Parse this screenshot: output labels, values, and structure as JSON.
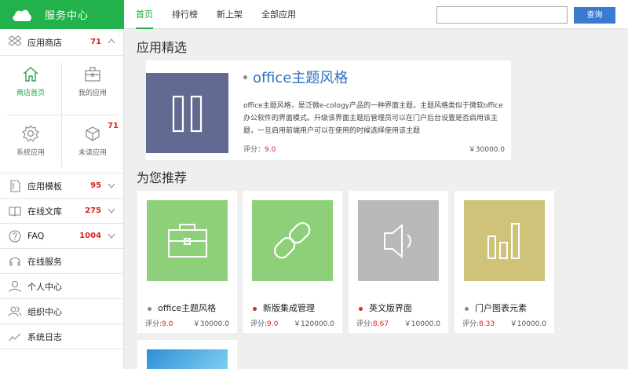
{
  "brand": {
    "title": "服务中心"
  },
  "nav": {
    "tabs": [
      "首页",
      "排行榜",
      "新上架",
      "全部应用"
    ]
  },
  "search": {
    "placeholder": "",
    "button": "查询"
  },
  "sidebar": {
    "app_store": {
      "label": "应用商店",
      "count": "71"
    },
    "grid": [
      {
        "label": "商店首页",
        "icon": "home-icon"
      },
      {
        "label": "我的应用",
        "icon": "toolbox-icon"
      },
      {
        "label": "系统应用",
        "icon": "gear-icon"
      },
      {
        "label": "未读应用",
        "icon": "box-icon",
        "badge": "71"
      }
    ],
    "items": [
      {
        "label": "应用模板",
        "count": "95",
        "icon": "template-icon"
      },
      {
        "label": "在线文库",
        "count": "275",
        "icon": "book-icon"
      },
      {
        "label": "FAQ",
        "count": "1004",
        "icon": "question-icon"
      },
      {
        "label": "在线服务",
        "icon": "headset-icon"
      },
      {
        "label": "个人中心",
        "icon": "user-icon"
      },
      {
        "label": "组织中心",
        "icon": "org-icon"
      },
      {
        "label": "系统日志",
        "icon": "chart-line-icon"
      }
    ]
  },
  "featured_section": {
    "title": "应用精选"
  },
  "featured": {
    "title": "office主题风格",
    "description": "office主题风格，是泛微e-cology产品的一种界面主题，主题风格类似于微软office办公软件的界面模式。升级该界面主题后管理员可以在门户后台设置是否启用该主题，一旦启用前端用户可以在使用的时候选择使用该主题",
    "rating_label": "评分：",
    "rating": "9.0",
    "price": "￥30000.0"
  },
  "recommend_section": {
    "title": "为您推荐"
  },
  "cards": [
    {
      "title": "office主题风格",
      "rating_label": "评分:",
      "rating": "9.0",
      "price": "￥30000.0",
      "color": "#8ed07a",
      "dot": "#888888",
      "icon": "briefcase-icon"
    },
    {
      "title": "新版集成管理",
      "rating_label": "评分:",
      "rating": "9.0",
      "price": "￥120000.0",
      "color": "#8ed07a",
      "dot": "#d9301e",
      "icon": "link-icon"
    },
    {
      "title": "英文版界面",
      "rating_label": "评分:",
      "rating": "8.67",
      "price": "￥10000.0",
      "color": "#b9b9b9",
      "dot": "#d9301e",
      "icon": "speaker-icon"
    },
    {
      "title": "门户图表元素",
      "rating_label": "评分:",
      "rating": "8.33",
      "price": "￥10000.0",
      "color": "#cfc37a",
      "dot": "#888888",
      "icon": "bar-chart-icon"
    }
  ],
  "colors": {
    "brand_green": "#22b24c",
    "accent_blue": "#2e6fc0",
    "count_red": "#e02020",
    "search_blue": "#3a7bd0"
  }
}
